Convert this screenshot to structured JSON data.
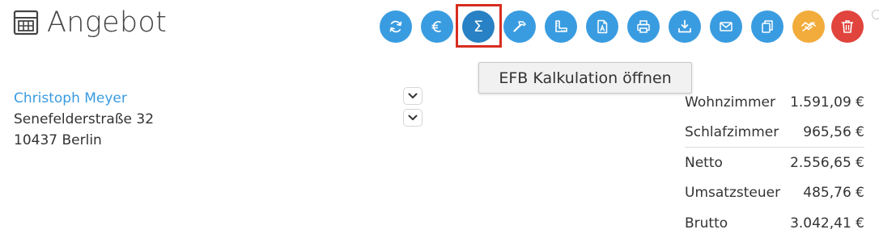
{
  "header": {
    "title": "Angebot",
    "title_icon": "calculator-icon"
  },
  "toolbar": {
    "buttons": [
      {
        "name": "refresh-button",
        "icon": "refresh-icon",
        "color": "#3a9ce0"
      },
      {
        "name": "currency-button",
        "icon": "euro-icon",
        "color": "#3a9ce0"
      },
      {
        "name": "efb-calculation-button",
        "icon": "sigma-icon",
        "color": "#2781c4",
        "active": true
      },
      {
        "name": "tools-button",
        "icon": "hammer-icon",
        "color": "#3a9ce0"
      },
      {
        "name": "measure-button",
        "icon": "ruler-icon",
        "color": "#3a9ce0"
      },
      {
        "name": "pdf-button",
        "icon": "pdf-file-icon",
        "color": "#3a9ce0"
      },
      {
        "name": "print-button",
        "icon": "printer-icon",
        "color": "#3a9ce0"
      },
      {
        "name": "download-button",
        "icon": "download-icon",
        "color": "#3a9ce0"
      },
      {
        "name": "email-button",
        "icon": "envelope-icon",
        "color": "#3a9ce0"
      },
      {
        "name": "copy-button",
        "icon": "copy-icon",
        "color": "#3a9ce0"
      },
      {
        "name": "handshake-button",
        "icon": "handshake-icon",
        "color": "#f1ac3c"
      },
      {
        "name": "delete-button",
        "icon": "trash-icon",
        "color": "#e0443d"
      }
    ],
    "sigma_glyph": "Σ",
    "highlight_color": "#d72d1f"
  },
  "tooltip": {
    "text": "EFB Kalkulation öffnen"
  },
  "customer": {
    "name": "Christoph Meyer",
    "street": "Senefelderstraße 32",
    "city": "10437 Berlin"
  },
  "summary": {
    "rows": [
      {
        "label": "Wohnzimmer",
        "value": "1.591,09 €"
      },
      {
        "label": "Schlafzimmer",
        "value": "965,56 €"
      },
      {
        "label": "Netto",
        "value": "2.556,65 €"
      },
      {
        "label": "Umsatzsteuer",
        "value": "485,76 €"
      },
      {
        "label": "Brutto",
        "value": "3.042,41 €"
      }
    ]
  },
  "colors": {
    "accent": "#3a9ce0",
    "accent_active": "#2781c4",
    "warning": "#f1ac3c",
    "danger": "#e0443d"
  }
}
